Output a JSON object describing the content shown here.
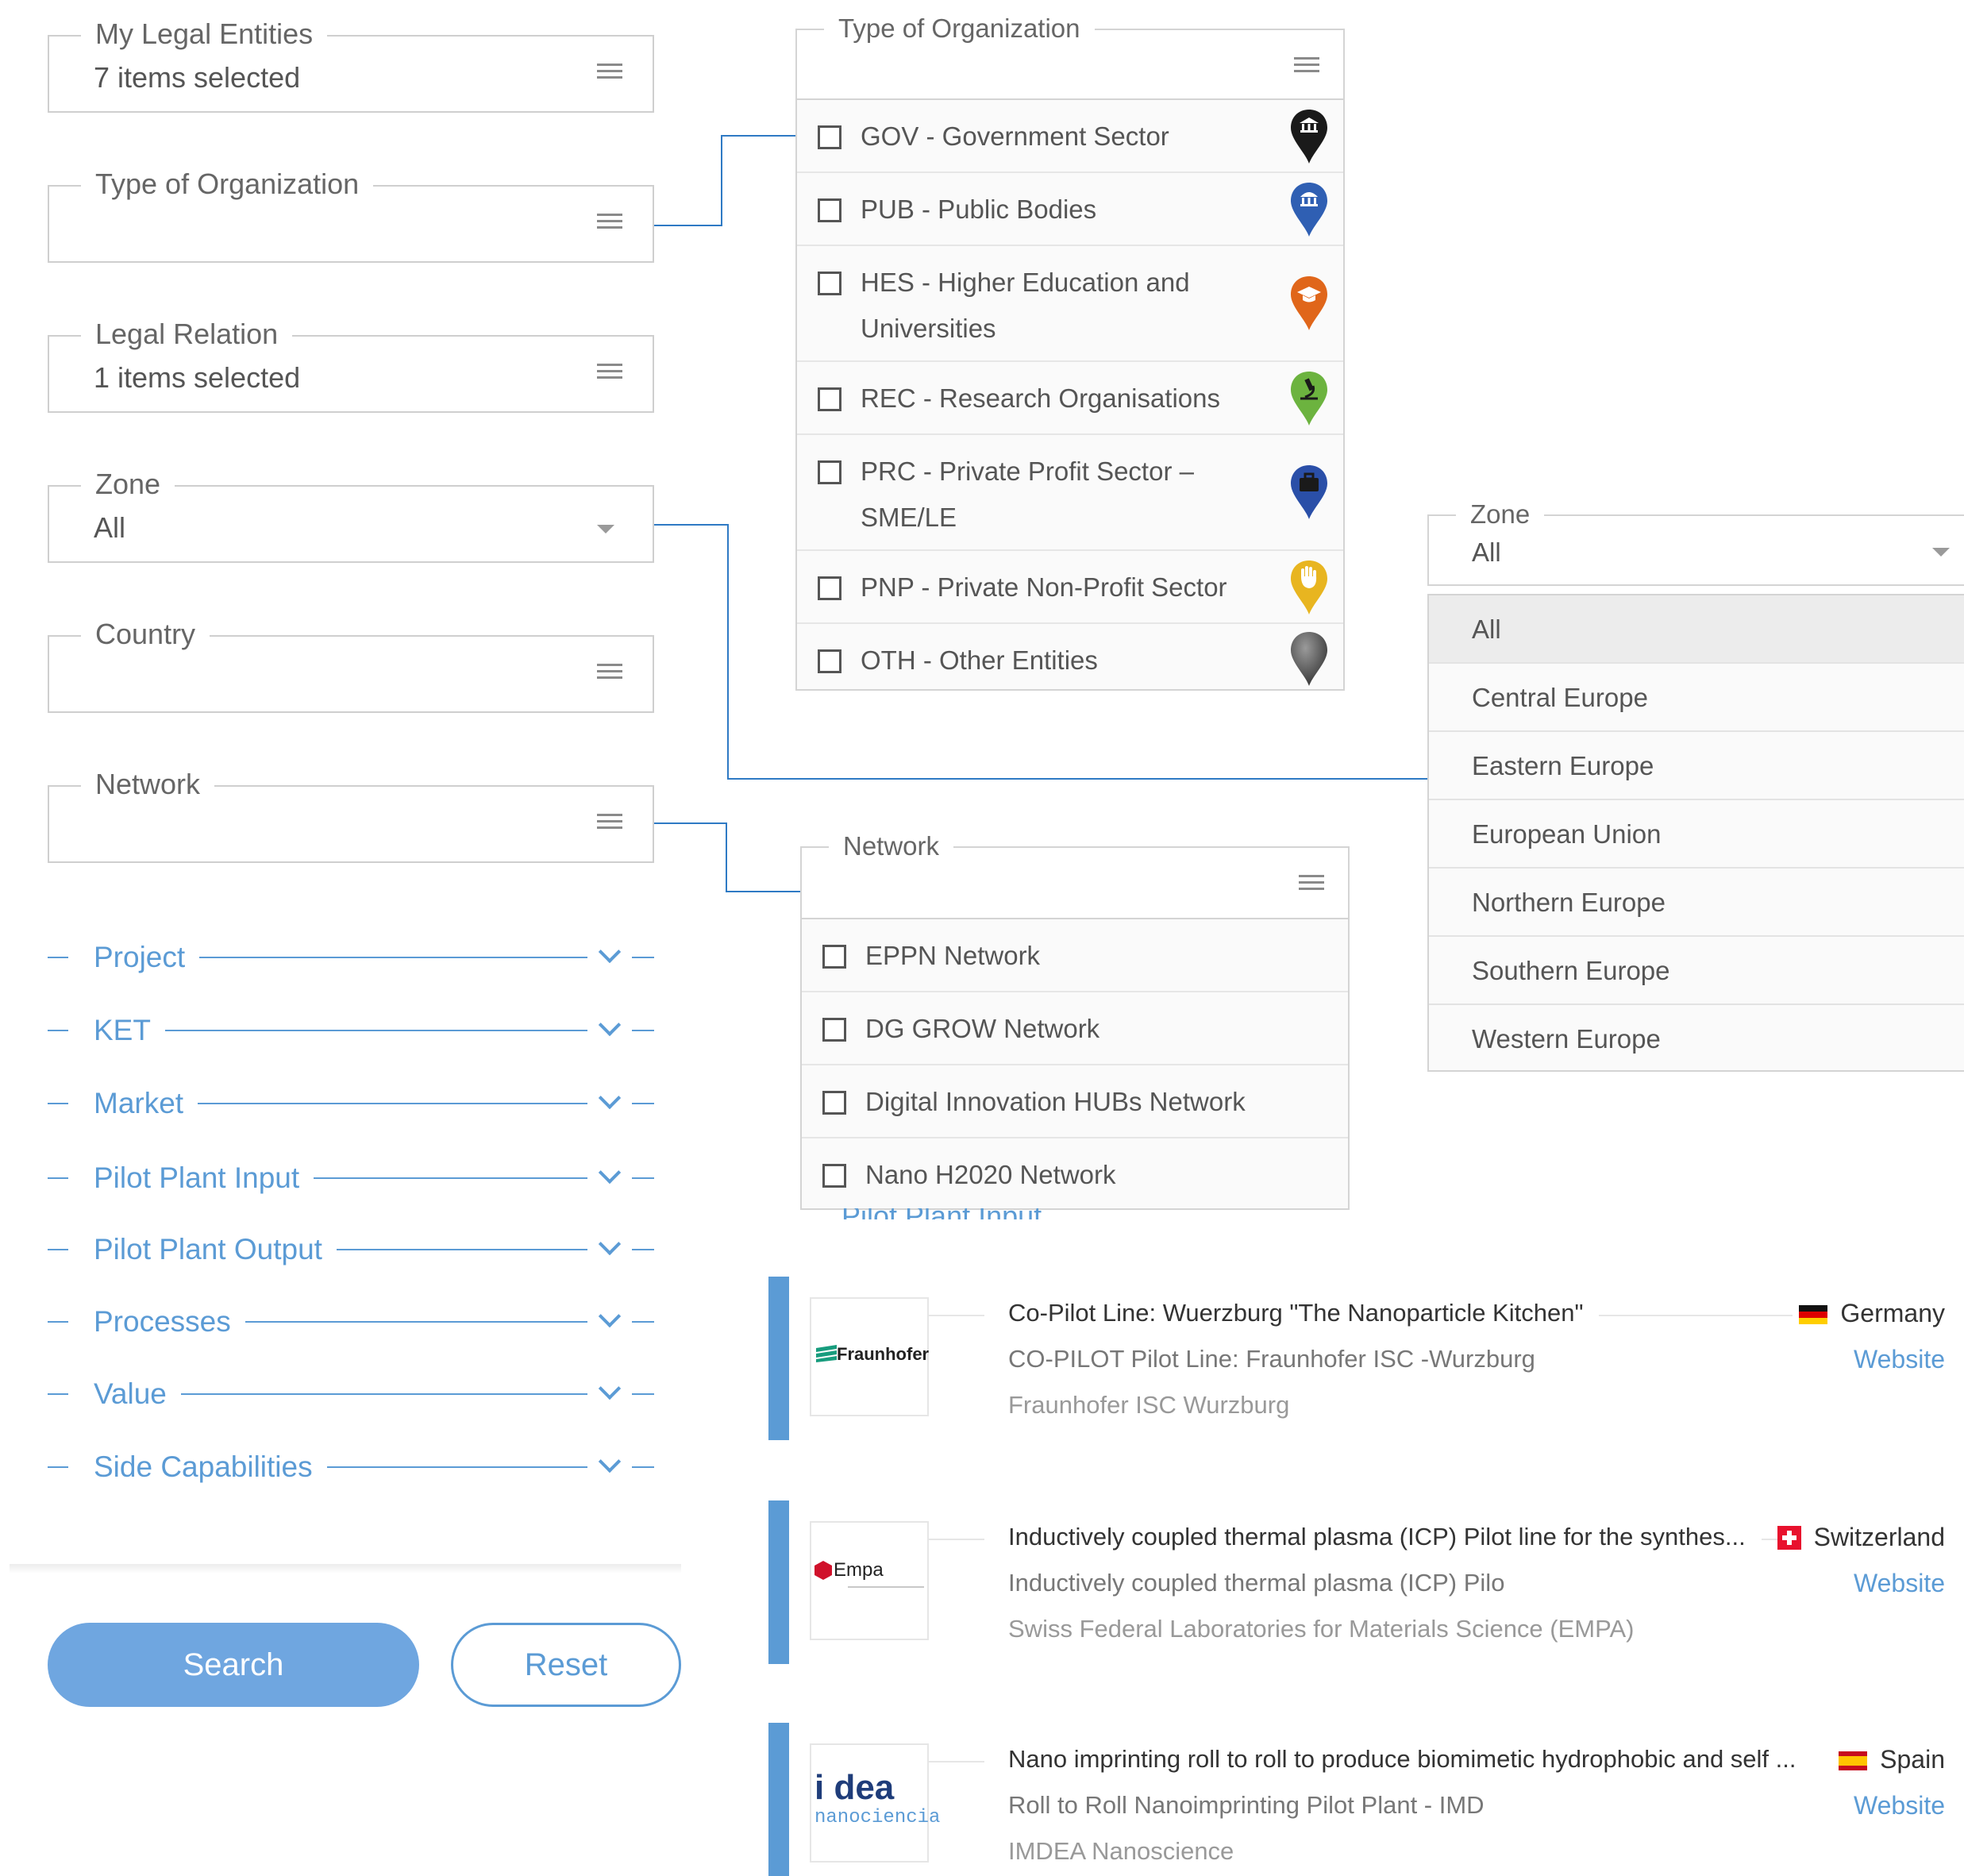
{
  "filters": {
    "my_legal_entities": {
      "label": "My Legal Entities",
      "value": "7 items selected"
    },
    "type_of_organization": {
      "label": "Type of Organization",
      "value": ""
    },
    "legal_relation": {
      "label": "Legal Relation",
      "value": "1 items selected"
    },
    "zone": {
      "label": "Zone",
      "value": "All"
    },
    "country": {
      "label": "Country",
      "value": ""
    },
    "network": {
      "label": "Network",
      "value": ""
    }
  },
  "sections": [
    {
      "label": "Project"
    },
    {
      "label": "KET"
    },
    {
      "label": "Market"
    },
    {
      "label": "Pilot Plant Input"
    },
    {
      "label": "Pilot Plant Output"
    },
    {
      "label": "Processes"
    },
    {
      "label": "Value"
    },
    {
      "label": "Side Capabilities"
    }
  ],
  "buttons": {
    "search": "Search",
    "reset": "Reset"
  },
  "org_dropdown": {
    "label": "Type of Organization",
    "options": [
      {
        "line1": "GOV - Government Sector",
        "line2": "",
        "pin_color": "#1a1a1a",
        "icon": "government-building-icon"
      },
      {
        "line1": "PUB - Public Bodies",
        "line2": "",
        "pin_color": "#2f5fb3",
        "icon": "public-building-icon"
      },
      {
        "line1": "HES - Higher Education and",
        "line2": "Universities",
        "pin_color": "#e0661a",
        "icon": "graduation-cap-icon"
      },
      {
        "line1": "REC - Research Organisations",
        "line2": "",
        "pin_color": "#6cb33f",
        "icon": "microscope-icon"
      },
      {
        "line1": "PRC - Private Profit Sector –",
        "line2": "SME/LE",
        "pin_color": "#2a4fa8",
        "icon": "briefcase-icon"
      },
      {
        "line1": "PNP - Private Non-Profit Sector",
        "line2": "",
        "pin_color": "#e8b520",
        "icon": "hand-icon"
      },
      {
        "line1": "OTH - Other Entities",
        "line2": "",
        "pin_color": "#555555",
        "icon": "generic-marker-icon"
      }
    ]
  },
  "network_dropdown": {
    "label": "Network",
    "options": [
      "EPPN Network",
      "DG GROW Network",
      "Digital Innovation HUBs Network",
      "Nano H2020 Network"
    ],
    "peek_text": "Pilot Plant Input"
  },
  "zone_dropdown": {
    "label": "Zone",
    "value": "All",
    "options": [
      "All",
      "Central Europe",
      "Eastern Europe",
      "European Union",
      "Northern Europe",
      "Southern Europe",
      "Western Europe"
    ]
  },
  "results": [
    {
      "title": "Co-Pilot Line: Wuerzburg \"The Nanoparticle Kitchen\"",
      "subtitle": "CO-PILOT Pilot Line: Fraunhofer ISC -Wurzburg",
      "org": "Fraunhofer ISC Wurzburg",
      "country": "Germany",
      "website": "Website",
      "logo": "Fraunhofer"
    },
    {
      "title": "Inductively coupled thermal plasma (ICP) Pilot line for the synthes...",
      "subtitle": "Inductively coupled thermal plasma (ICP) Pilo",
      "org": "Swiss Federal Laboratories for Materials Science (EMPA)",
      "country": "Switzerland",
      "website": "Website",
      "logo": "Empa"
    },
    {
      "title": "Nano imprinting roll to roll to produce biomimetic hydrophobic and self ...",
      "subtitle": "Roll to Roll Nanoimprinting Pilot Plant - IMD",
      "org": "IMDEA Nanoscience",
      "country": "Spain",
      "website": "Website",
      "logo_top": "i dea",
      "logo_bottom": "nanociencia"
    }
  ],
  "colors": {
    "accent": "#5b9bd5",
    "connector": "#2f7ac4"
  }
}
